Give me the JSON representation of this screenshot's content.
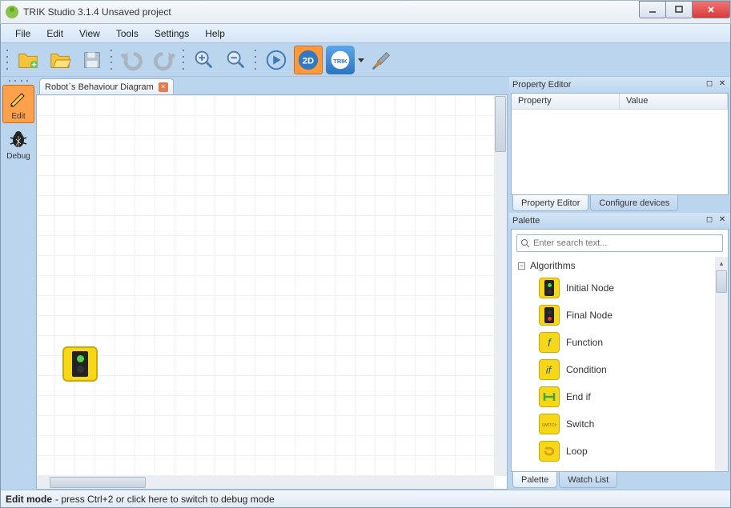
{
  "window": {
    "title": "TRIK Studio 3.1.4 Unsaved project"
  },
  "menu": {
    "items": [
      "File",
      "Edit",
      "View",
      "Tools",
      "Settings",
      "Help"
    ]
  },
  "toolbar": {
    "two_d_label": "2D",
    "trik_label": "TRIK"
  },
  "mode_tabs": {
    "edit": "Edit",
    "debug": "Debug"
  },
  "document_tab": {
    "label": "Robot`s Behaviour Diagram"
  },
  "property_panel": {
    "title": "Property Editor",
    "columns": {
      "property": "Property",
      "value": "Value"
    },
    "tabs": {
      "editor": "Property Editor",
      "configure": "Configure devices"
    }
  },
  "palette_panel": {
    "title": "Palette",
    "search_placeholder": "Enter search text...",
    "category": "Algorithms",
    "items": [
      {
        "label": "Initial Node",
        "type": "initial"
      },
      {
        "label": "Final Node",
        "type": "final"
      },
      {
        "label": "Function",
        "type": "function"
      },
      {
        "label": "Condition",
        "type": "condition"
      },
      {
        "label": "End if",
        "type": "endif"
      },
      {
        "label": "Switch",
        "type": "switch"
      },
      {
        "label": "Loop",
        "type": "loop"
      }
    ],
    "tabs": {
      "palette": "Palette",
      "watch": "Watch List"
    }
  },
  "status": {
    "mode": "Edit mode",
    "hint": " - press Ctrl+2 or click here to switch to debug mode"
  }
}
